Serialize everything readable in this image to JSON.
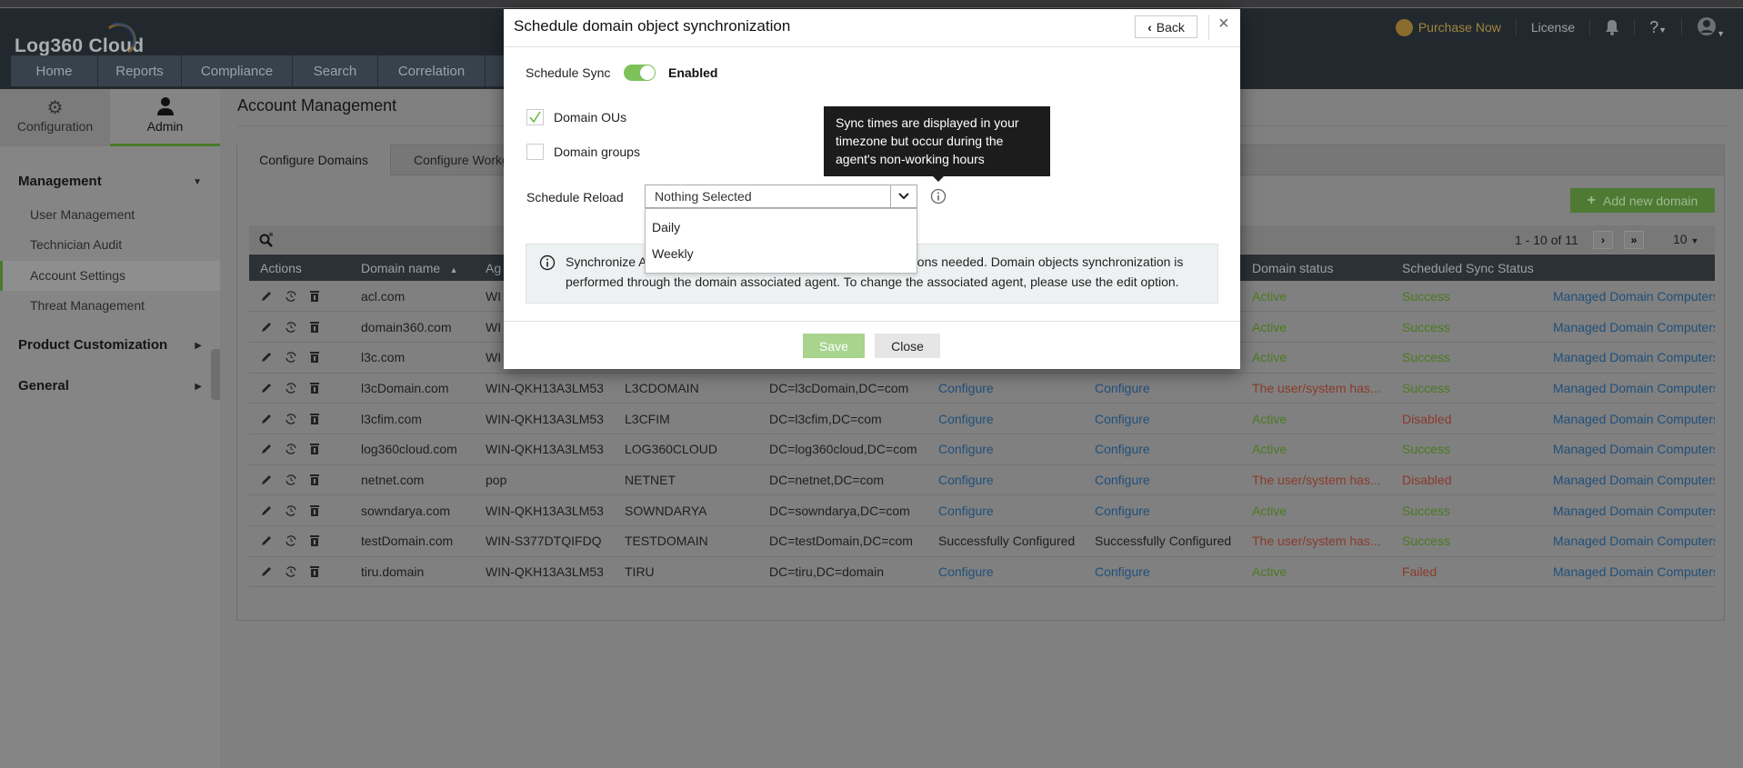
{
  "app": {
    "logo": "Log360 Cloud"
  },
  "topbar": {
    "purchase": "Purchase Now",
    "license": "License",
    "help": "?"
  },
  "nav": [
    "Home",
    "Reports",
    "Compliance",
    "Search",
    "Correlation"
  ],
  "sidebar": {
    "tabs": [
      "Configuration",
      "Admin"
    ],
    "sections": [
      {
        "label": "Management",
        "items": [
          "User Management",
          "Technician Audit",
          "Account Settings",
          "Threat Management"
        ]
      },
      {
        "label": "Product Customization"
      },
      {
        "label": "General"
      }
    ]
  },
  "main": {
    "title": "Account Management",
    "tabs": [
      "Configure Domains",
      "Configure Workg"
    ],
    "add_button": "Add new domain",
    "pagination": {
      "range": "1 - 10 of 11",
      "per_page": "10"
    },
    "columns": [
      "Actions",
      "Domain name",
      "Ag",
      "",
      "",
      "",
      "",
      "Domain status",
      "Scheduled Sync Status",
      ""
    ],
    "rows": [
      {
        "domain": "acl.com",
        "agent": "WI",
        "netbios": "",
        "dn": "",
        "c1": "",
        "c2": "",
        "status": "Active",
        "sync": "Success",
        "link": "Managed Domain Computers"
      },
      {
        "domain": "domain360.com",
        "agent": "WI",
        "netbios": "",
        "dn": "",
        "c1": "",
        "c2": "",
        "status": "Active",
        "sync": "Success",
        "link": "Managed Domain Computers"
      },
      {
        "domain": "l3c.com",
        "agent": "WI",
        "netbios": "",
        "dn": "",
        "c1": "",
        "c2": "",
        "status": "Active",
        "sync": "Success",
        "link": "Managed Domain Computers"
      },
      {
        "domain": "l3cDomain.com",
        "agent": "WIN-QKH13A3LM53",
        "netbios": "L3CDOMAIN",
        "dn": "DC=l3cDomain,DC=com",
        "c1": "Configure",
        "c2": "Configure",
        "status": "The user/system has...",
        "sync": "Success",
        "link": "Managed Domain Computers"
      },
      {
        "domain": "l3cfim.com",
        "agent": "WIN-QKH13A3LM53",
        "netbios": "L3CFIM",
        "dn": "DC=l3cfim,DC=com",
        "c1": "Configure",
        "c2": "Configure",
        "status": "Active",
        "sync": "Disabled",
        "link": "Managed Domain Computers"
      },
      {
        "domain": "log360cloud.com",
        "agent": "WIN-QKH13A3LM53",
        "netbios": "LOG360CLOUD",
        "dn": "DC=log360cloud,DC=com",
        "c1": "Configure",
        "c2": "Configure",
        "status": "Active",
        "sync": "Success",
        "link": "Managed Domain Computers"
      },
      {
        "domain": "netnet.com",
        "agent": "pop",
        "netbios": "NETNET",
        "dn": "DC=netnet,DC=com",
        "c1": "Configure",
        "c2": "Configure",
        "status": "The user/system has...",
        "sync": "Disabled",
        "link": "Managed Domain Computers"
      },
      {
        "domain": "sowndarya.com",
        "agent": "WIN-QKH13A3LM53",
        "netbios": "SOWNDARYA",
        "dn": "DC=sowndarya,DC=com",
        "c1": "Configure",
        "c2": "Configure",
        "status": "Active",
        "sync": "Success",
        "link": "Managed Domain Computers"
      },
      {
        "domain": "testDomain.com",
        "agent": "WIN-S377DTQIFDQ",
        "netbios": "TESTDOMAIN",
        "dn": "DC=testDomain,DC=com",
        "c1": "Successfully Configured",
        "c2": "Successfully Configured",
        "status": "The user/system has...",
        "sync": "Success",
        "link": "Managed Domain Computers"
      },
      {
        "domain": "tiru.domain",
        "agent": "WIN-QKH13A3LM53",
        "netbios": "TIRU",
        "dn": "DC=tiru,DC=domain",
        "c1": "Configure",
        "c2": "Configure",
        "status": "Active",
        "sync": "Failed",
        "link": "Managed Domain Computers"
      }
    ]
  },
  "modal": {
    "title": "Schedule domain object synchronization",
    "back": "Back",
    "schedule_sync_label": "Schedule Sync",
    "schedule_sync_state": "Enabled",
    "domain_ous": {
      "label": "Domain OUs",
      "checked": true
    },
    "domain_groups": {
      "label": "Domain groups",
      "checked": false
    },
    "schedule_reload_label": "Schedule Reload",
    "select_value": "Nothing Selected",
    "options": [
      "Daily",
      "Weekly"
    ],
    "tooltip": "Sync times are displayed in your timezone but occur during the agent's non-working hours",
    "info_left": "Synchronize A",
    "info_right": "ptions needed. Domain objects synchronization is",
    "info_line2": "performed through the domain associated agent. To change the associated agent, please use the edit option.",
    "save": "Save",
    "close": "Close"
  },
  "colors": {
    "accent": "#7cc15a",
    "ok": "#4a7a1f",
    "bad": "#8a3a2a",
    "link": "#1f4f7a"
  }
}
